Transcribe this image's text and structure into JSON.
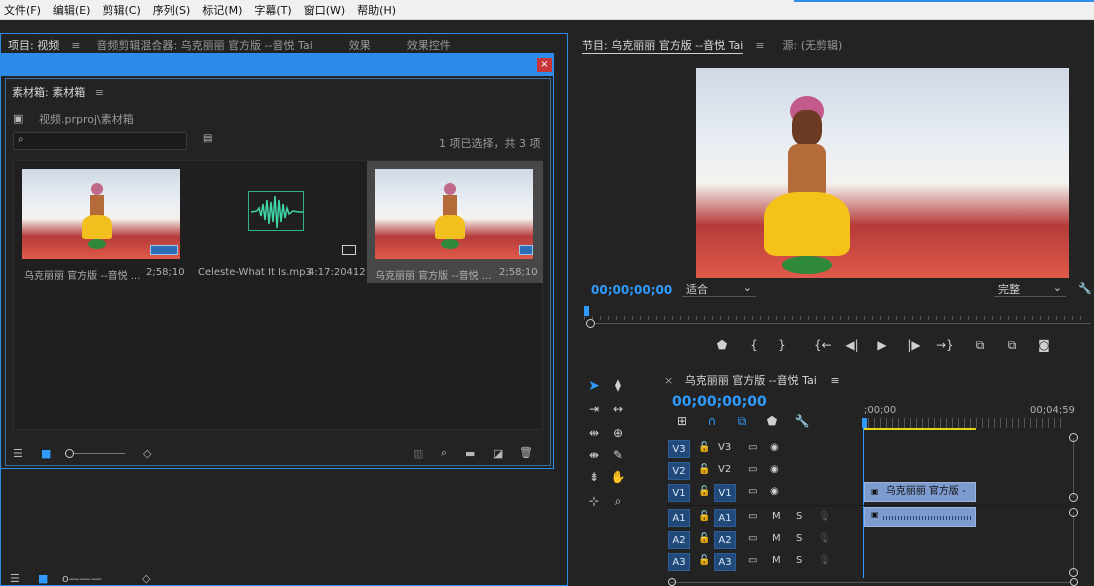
{
  "menu": [
    "文件(F)",
    "编辑(E)",
    "剪辑(C)",
    "序列(S)",
    "标记(M)",
    "字幕(T)",
    "窗口(W)",
    "帮助(H)"
  ],
  "left_tabs": {
    "project": "项目: 视频",
    "audio_mixer": "音频剪辑混合器: 乌克丽丽 官方版 --音悦 Tai",
    "effects": "效果",
    "effect_controls": "效果控件"
  },
  "bin": {
    "title": "素材箱: 素材箱",
    "path": "视频.prproj\\素材箱",
    "selection_info": "1 项已选择，共 3 项",
    "search_placeholder": "",
    "items": [
      {
        "name": "乌克丽丽 官方版 --音悦 ...",
        "duration": "2;58;10"
      },
      {
        "name": "Celeste-What It Is.mp3",
        "duration": "4:17:20412"
      },
      {
        "name": "乌克丽丽 官方版 --音悦 ...",
        "duration": "2;58;10"
      }
    ]
  },
  "program": {
    "tab": "节目: 乌克丽丽 官方版 --音悦 Tai",
    "source_tab": "源: (无剪辑)",
    "timecode": "00;00;00;00",
    "fit": "适合",
    "quality": "完整"
  },
  "timeline": {
    "tab": "乌克丽丽 官方版 --音悦 Tai",
    "timecode": "00;00;00;00",
    "ruler_start": ";00;00",
    "ruler_end": "00;04;59",
    "video_tracks": [
      {
        "name": "V3",
        "src": "V3"
      },
      {
        "name": "V2",
        "src": "V2"
      },
      {
        "name": "V1",
        "src": "V1"
      }
    ],
    "audio_tracks": [
      {
        "name": "A1",
        "src": "A1"
      },
      {
        "name": "A2",
        "src": "A2"
      },
      {
        "name": "A3",
        "src": "A3"
      }
    ],
    "clip_label": "乌克丽丽 官方版 -",
    "mute": "M",
    "solo": "S"
  },
  "colors": {
    "accent": "#2f9bff",
    "bg": "#232323",
    "track_blue": "#214a7a",
    "clip_blue": "#7e9bd0"
  }
}
